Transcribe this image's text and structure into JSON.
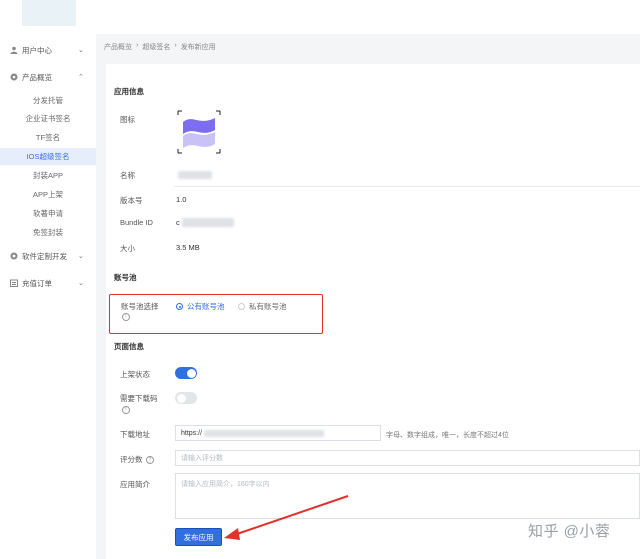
{
  "sidebar": {
    "groups": [
      {
        "label": "用户中心",
        "icon": "user-icon"
      },
      {
        "label": "产品概览",
        "icon": "product-icon"
      },
      {
        "label": "软件定制开发",
        "icon": "gear-icon"
      },
      {
        "label": "充值订单",
        "icon": "order-icon"
      }
    ],
    "items": [
      {
        "label": "分发托管"
      },
      {
        "label": "企业证书签名"
      },
      {
        "label": "TF签名"
      },
      {
        "label": "IOS超级签名"
      },
      {
        "label": "封装APP"
      },
      {
        "label": "APP上架"
      },
      {
        "label": "软著申请"
      },
      {
        "label": "免签封装"
      }
    ]
  },
  "breadcrumb": [
    "产品概览",
    "超级签名",
    "发布新应用"
  ],
  "app_info": {
    "section_title": "应用信息",
    "icon_label": "图标",
    "name_label": "名称",
    "version_label": "版本号",
    "version_value": "1.0",
    "bundle_label": "Bundle ID",
    "bundle_prefix": "c",
    "size_label": "大小",
    "size_value": "3.5 MB"
  },
  "account_pool": {
    "section_title": "账号池",
    "select_label": "账号池选择",
    "options": [
      "公有账号池",
      "私有账号池"
    ]
  },
  "page_info": {
    "section_title": "页面信息",
    "listing_label": "上架状态",
    "password_label": "需要下载码",
    "url_label": "下载地址",
    "url_prefix": "https://",
    "url_hint": "字母、数字组成，唯一，长度不超过4位",
    "score_label": "评分数",
    "score_placeholder": "请输入评分数",
    "intro_label": "应用简介",
    "intro_placeholder": "请输入应用简介，160字以内"
  },
  "submit_label": "发布应用",
  "watermark": "知乎 @小蓉",
  "colors": {
    "accent": "#2f6fe0",
    "highlight": "#e0322b"
  }
}
